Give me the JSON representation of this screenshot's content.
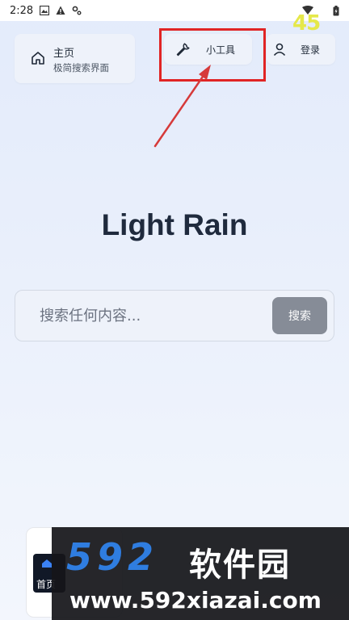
{
  "status_bar": {
    "time": "2:28",
    "fps": "45"
  },
  "nav": {
    "home_title": "主页",
    "home_subtitle": "极简搜索界面",
    "tools_label": "小工具",
    "login_label": "登录"
  },
  "main": {
    "title": "Light Rain"
  },
  "search": {
    "placeholder": "搜索任何内容...",
    "button_label": "搜索"
  },
  "bottom_card": {
    "label": "首页"
  },
  "watermark": {
    "logo": "592",
    "name": "软件园",
    "url": "www.592xiazai.com"
  },
  "colors": {
    "annotation": "#e02424",
    "search_button": "#868c97",
    "watermark_logo": "#2f7de0"
  }
}
